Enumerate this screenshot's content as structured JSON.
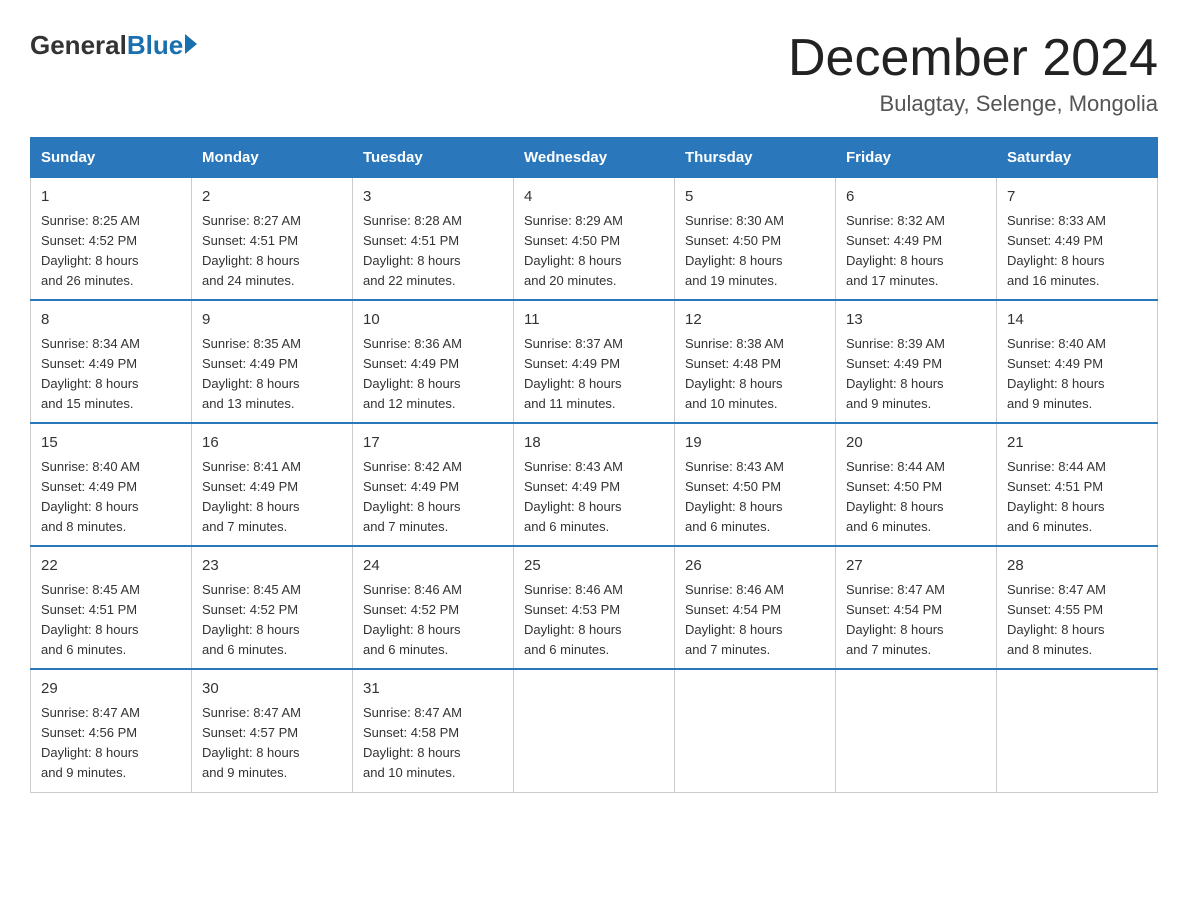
{
  "logo": {
    "general": "General",
    "blue": "Blue"
  },
  "header": {
    "month": "December 2024",
    "location": "Bulagtay, Selenge, Mongolia"
  },
  "weekdays": [
    "Sunday",
    "Monday",
    "Tuesday",
    "Wednesday",
    "Thursday",
    "Friday",
    "Saturday"
  ],
  "weeks": [
    [
      {
        "day": "1",
        "sunrise": "8:25 AM",
        "sunset": "4:52 PM",
        "daylight": "8 hours and 26 minutes."
      },
      {
        "day": "2",
        "sunrise": "8:27 AM",
        "sunset": "4:51 PM",
        "daylight": "8 hours and 24 minutes."
      },
      {
        "day": "3",
        "sunrise": "8:28 AM",
        "sunset": "4:51 PM",
        "daylight": "8 hours and 22 minutes."
      },
      {
        "day": "4",
        "sunrise": "8:29 AM",
        "sunset": "4:50 PM",
        "daylight": "8 hours and 20 minutes."
      },
      {
        "day": "5",
        "sunrise": "8:30 AM",
        "sunset": "4:50 PM",
        "daylight": "8 hours and 19 minutes."
      },
      {
        "day": "6",
        "sunrise": "8:32 AM",
        "sunset": "4:49 PM",
        "daylight": "8 hours and 17 minutes."
      },
      {
        "day": "7",
        "sunrise": "8:33 AM",
        "sunset": "4:49 PM",
        "daylight": "8 hours and 16 minutes."
      }
    ],
    [
      {
        "day": "8",
        "sunrise": "8:34 AM",
        "sunset": "4:49 PM",
        "daylight": "8 hours and 15 minutes."
      },
      {
        "day": "9",
        "sunrise": "8:35 AM",
        "sunset": "4:49 PM",
        "daylight": "8 hours and 13 minutes."
      },
      {
        "day": "10",
        "sunrise": "8:36 AM",
        "sunset": "4:49 PM",
        "daylight": "8 hours and 12 minutes."
      },
      {
        "day": "11",
        "sunrise": "8:37 AM",
        "sunset": "4:49 PM",
        "daylight": "8 hours and 11 minutes."
      },
      {
        "day": "12",
        "sunrise": "8:38 AM",
        "sunset": "4:48 PM",
        "daylight": "8 hours and 10 minutes."
      },
      {
        "day": "13",
        "sunrise": "8:39 AM",
        "sunset": "4:49 PM",
        "daylight": "8 hours and 9 minutes."
      },
      {
        "day": "14",
        "sunrise": "8:40 AM",
        "sunset": "4:49 PM",
        "daylight": "8 hours and 9 minutes."
      }
    ],
    [
      {
        "day": "15",
        "sunrise": "8:40 AM",
        "sunset": "4:49 PM",
        "daylight": "8 hours and 8 minutes."
      },
      {
        "day": "16",
        "sunrise": "8:41 AM",
        "sunset": "4:49 PM",
        "daylight": "8 hours and 7 minutes."
      },
      {
        "day": "17",
        "sunrise": "8:42 AM",
        "sunset": "4:49 PM",
        "daylight": "8 hours and 7 minutes."
      },
      {
        "day": "18",
        "sunrise": "8:43 AM",
        "sunset": "4:49 PM",
        "daylight": "8 hours and 6 minutes."
      },
      {
        "day": "19",
        "sunrise": "8:43 AM",
        "sunset": "4:50 PM",
        "daylight": "8 hours and 6 minutes."
      },
      {
        "day": "20",
        "sunrise": "8:44 AM",
        "sunset": "4:50 PM",
        "daylight": "8 hours and 6 minutes."
      },
      {
        "day": "21",
        "sunrise": "8:44 AM",
        "sunset": "4:51 PM",
        "daylight": "8 hours and 6 minutes."
      }
    ],
    [
      {
        "day": "22",
        "sunrise": "8:45 AM",
        "sunset": "4:51 PM",
        "daylight": "8 hours and 6 minutes."
      },
      {
        "day": "23",
        "sunrise": "8:45 AM",
        "sunset": "4:52 PM",
        "daylight": "8 hours and 6 minutes."
      },
      {
        "day": "24",
        "sunrise": "8:46 AM",
        "sunset": "4:52 PM",
        "daylight": "8 hours and 6 minutes."
      },
      {
        "day": "25",
        "sunrise": "8:46 AM",
        "sunset": "4:53 PM",
        "daylight": "8 hours and 6 minutes."
      },
      {
        "day": "26",
        "sunrise": "8:46 AM",
        "sunset": "4:54 PM",
        "daylight": "8 hours and 7 minutes."
      },
      {
        "day": "27",
        "sunrise": "8:47 AM",
        "sunset": "4:54 PM",
        "daylight": "8 hours and 7 minutes."
      },
      {
        "day": "28",
        "sunrise": "8:47 AM",
        "sunset": "4:55 PM",
        "daylight": "8 hours and 8 minutes."
      }
    ],
    [
      {
        "day": "29",
        "sunrise": "8:47 AM",
        "sunset": "4:56 PM",
        "daylight": "8 hours and 9 minutes."
      },
      {
        "day": "30",
        "sunrise": "8:47 AM",
        "sunset": "4:57 PM",
        "daylight": "8 hours and 9 minutes."
      },
      {
        "day": "31",
        "sunrise": "8:47 AM",
        "sunset": "4:58 PM",
        "daylight": "8 hours and 10 minutes."
      },
      null,
      null,
      null,
      null
    ]
  ],
  "labels": {
    "sunrise": "Sunrise:",
    "sunset": "Sunset:",
    "daylight": "Daylight:"
  }
}
